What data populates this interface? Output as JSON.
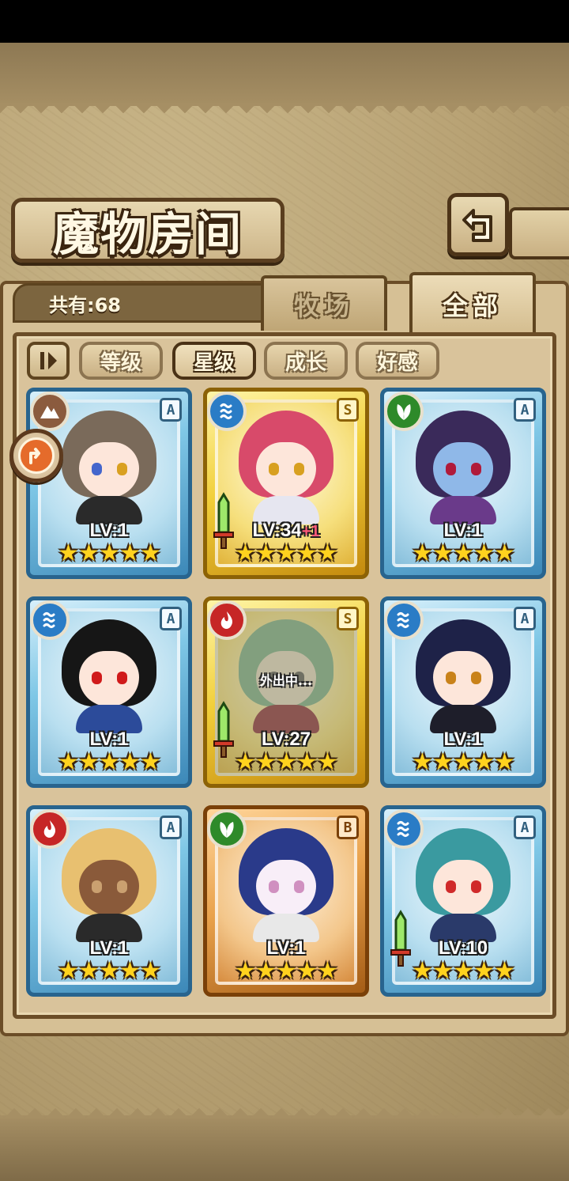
{
  "screen": {
    "title": "魔物房间",
    "count_label": "共有:68"
  },
  "tabs": [
    {
      "label": "牧场",
      "active": false
    },
    {
      "label": "全部",
      "active": true
    }
  ],
  "sort_buttons": [
    {
      "label": "等级",
      "active": false
    },
    {
      "label": "星级",
      "active": true
    },
    {
      "label": "成长",
      "active": false
    },
    {
      "label": "好感",
      "active": false
    }
  ],
  "monsters": [
    {
      "element": "earth",
      "rank": "A",
      "frame": "blue",
      "level": "LV:1",
      "bonus": "",
      "stars": 5,
      "equipped": false,
      "away": false,
      "hair": "#7a6a5a",
      "skin": "#fde6da",
      "eye_l": "#4466cc",
      "eye_r": "#d9a020",
      "outfit": "#2a2a2a"
    },
    {
      "element": "water",
      "rank": "S",
      "frame": "gold",
      "level": "LV:34",
      "bonus": "+1",
      "stars": 5,
      "equipped": true,
      "away": false,
      "hair": "#d84a6a",
      "skin": "#fde6da",
      "eye_l": "#d8a020",
      "eye_r": "#d8a020",
      "outfit": "#e6e6f0"
    },
    {
      "element": "nature",
      "rank": "A",
      "frame": "blue",
      "level": "LV:1",
      "bonus": "",
      "stars": 5,
      "equipped": false,
      "away": false,
      "hair": "#3a2a5a",
      "skin": "#8fb8e8",
      "eye_l": "#b01a3a",
      "eye_r": "#b01a3a",
      "outfit": "#6a3a8a"
    },
    {
      "element": "water",
      "rank": "A",
      "frame": "blue",
      "level": "LV:1",
      "bonus": "",
      "stars": 5,
      "equipped": false,
      "away": false,
      "hair": "#161616",
      "skin": "#fde6da",
      "eye_l": "#d01a1a",
      "eye_r": "#d01a1a",
      "outfit": "#2c4b9a"
    },
    {
      "element": "fire",
      "rank": "S",
      "frame": "gold",
      "level": "LV:27",
      "bonus": "",
      "stars": 5,
      "equipped": true,
      "away": true,
      "away_text": "外出中...",
      "hair": "#7ab08a",
      "skin": "#e8dcc8",
      "eye_l": "#5a5a5a",
      "eye_r": "#5a5a5a",
      "outfit": "#8a2a3a"
    },
    {
      "element": "water",
      "rank": "A",
      "frame": "blue",
      "level": "LV:1",
      "bonus": "",
      "stars": 5,
      "equipped": false,
      "away": false,
      "hair": "#1e2248",
      "skin": "#fde6da",
      "eye_l": "#c9821a",
      "eye_r": "#c9821a",
      "outfit": "#1e1e2a"
    },
    {
      "element": "fire",
      "rank": "A",
      "frame": "blue",
      "level": "LV:1",
      "bonus": "",
      "stars": 5,
      "equipped": false,
      "away": false,
      "hair": "#e8c070",
      "skin": "#8a5a3a",
      "eye_l": "#caa070",
      "eye_r": "#caa070",
      "outfit": "#2a2a2a"
    },
    {
      "element": "nature",
      "rank": "B",
      "frame": "bronze",
      "level": "LV:1",
      "bonus": "",
      "stars": 5,
      "equipped": false,
      "away": false,
      "hair": "#2a3a8a",
      "skin": "#f8eef8",
      "eye_l": "#d090c0",
      "eye_r": "#d090c0",
      "outfit": "#e8e8e8"
    },
    {
      "element": "water",
      "rank": "A",
      "frame": "blue",
      "level": "LV:10",
      "bonus": "",
      "stars": 5,
      "equipped": true,
      "away": false,
      "hair": "#3a9aa0",
      "skin": "#fde6da",
      "eye_l": "#d02a2a",
      "eye_r": "#d02a2a",
      "outfit": "#2a3a6a"
    }
  ]
}
